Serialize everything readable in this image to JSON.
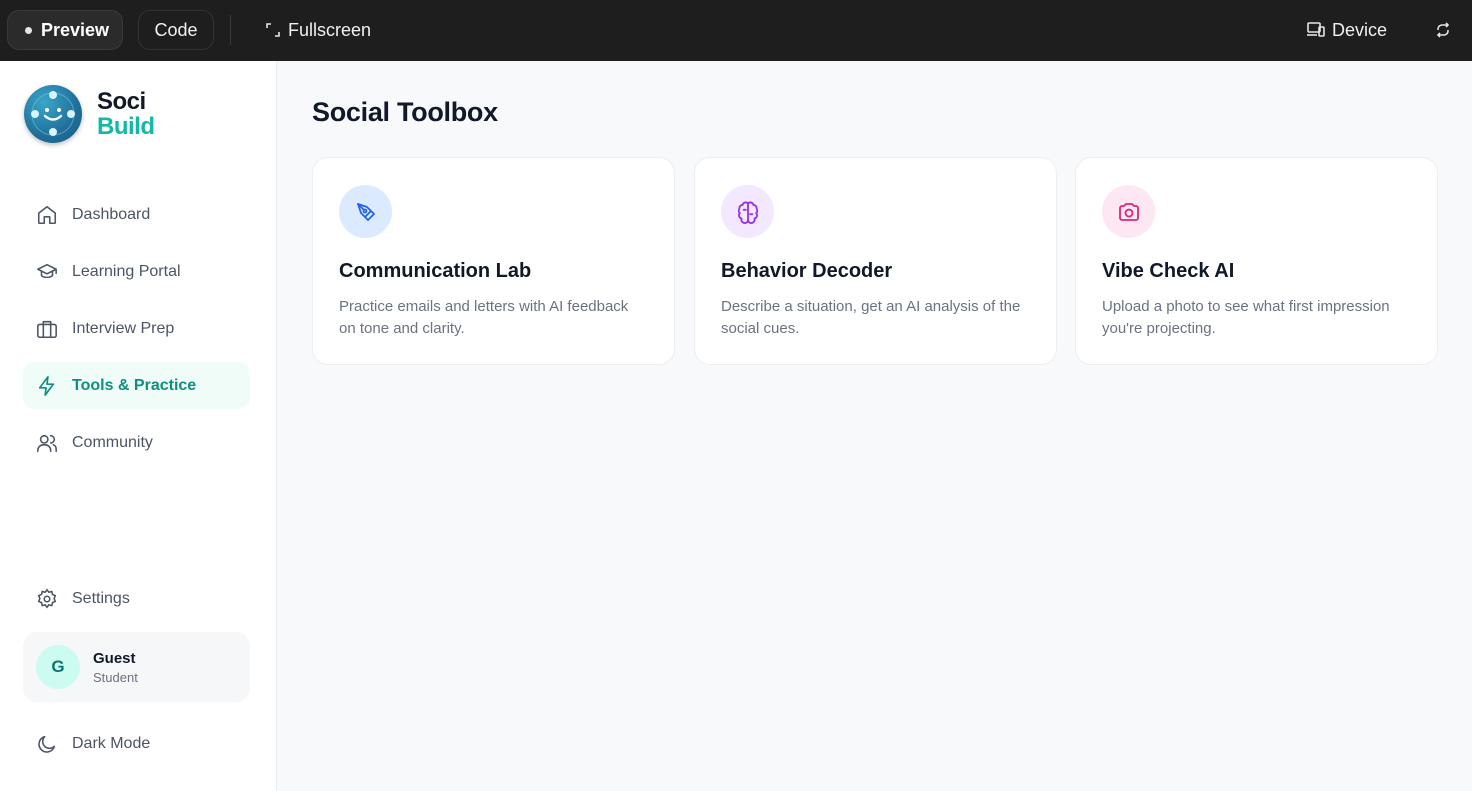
{
  "topbar": {
    "preview_label": "Preview",
    "code_label": "Code",
    "fullscreen_label": "Fullscreen",
    "device_label": "Device"
  },
  "brand": {
    "name_line1": "Soci",
    "name_line2": "Build",
    "accent_color": "#14b8a6"
  },
  "sidebar": {
    "items": [
      {
        "label": "Dashboard",
        "icon": "home-icon"
      },
      {
        "label": "Learning Portal",
        "icon": "graduation-cap-icon"
      },
      {
        "label": "Interview Prep",
        "icon": "briefcase-icon"
      },
      {
        "label": "Tools & Practice",
        "icon": "lightning-icon",
        "active": true
      },
      {
        "label": "Community",
        "icon": "users-icon"
      }
    ],
    "settings_label": "Settings",
    "user": {
      "initial": "G",
      "name": "Guest",
      "role": "Student"
    },
    "dark_mode_label": "Dark Mode"
  },
  "main": {
    "title": "Social Toolbox",
    "cards": [
      {
        "title": "Communication Lab",
        "description": "Practice emails and letters with AI feedback on tone and clarity.",
        "icon": "pen-tool-icon",
        "color": "#2563eb",
        "bg": "#dbeafe"
      },
      {
        "title": "Behavior Decoder",
        "description": "Describe a situation, get an AI analysis of the social cues.",
        "icon": "brain-icon",
        "color": "#9333ea",
        "bg": "#f3e8ff"
      },
      {
        "title": "Vibe Check AI",
        "description": "Upload a photo to see what first impression you're projecting.",
        "icon": "camera-icon",
        "color": "#db2777",
        "bg": "#fce7f3"
      }
    ]
  }
}
